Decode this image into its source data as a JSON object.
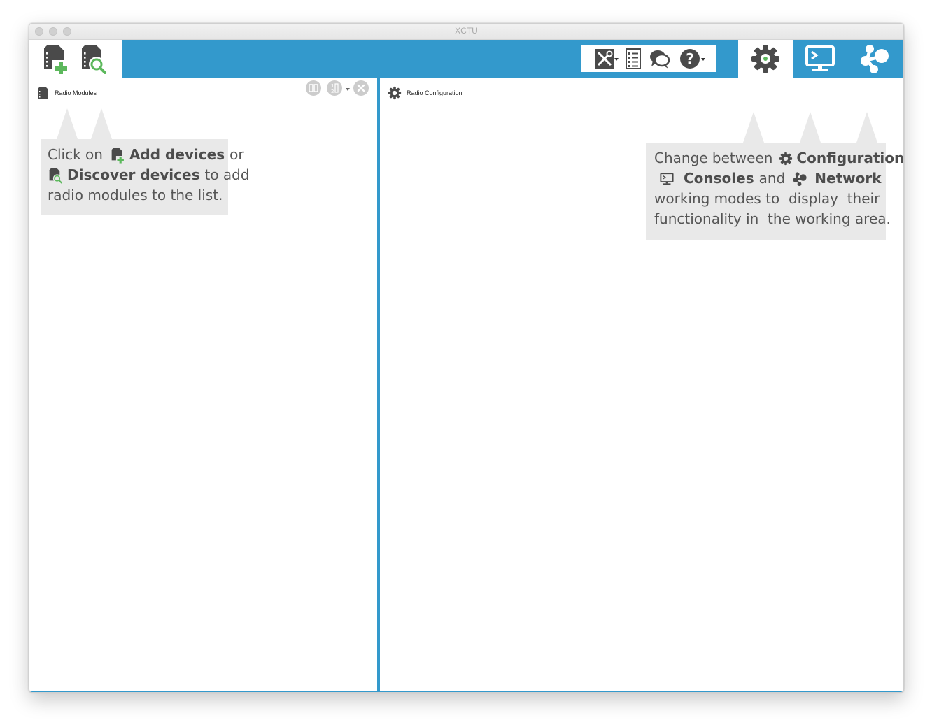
{
  "window": {
    "title": "XCTU"
  },
  "toolbar": {
    "left_buttons": [
      "add-devices",
      "discover-devices"
    ],
    "tools": [
      "tools",
      "xctu-log",
      "feedback",
      "help"
    ],
    "modes": [
      "configuration",
      "consoles",
      "network"
    ],
    "active_mode": "configuration"
  },
  "radio_modules": {
    "title": "Radio Modules",
    "tip": {
      "l1_a": "Click on",
      "l1_b": "Add devices",
      "l1_c": "or",
      "l2_b": "Discover devices",
      "l2_c": "to add",
      "l3": "radio modules to the list."
    }
  },
  "radio_configuration": {
    "title": "Radio Configuration",
    "tip": {
      "l1_a": "Change between",
      "l1_b": "Configuration",
      "l1_c": ",",
      "l2_b": "Consoles",
      "l2_c": "and",
      "l2_d": "Network",
      "l3": "working modes to  display  their",
      "l4": "functionality in  the working area."
    }
  },
  "colors": {
    "accent": "#3399cc",
    "tip_bg": "#e9e9e9",
    "icon_dark": "#4a4a4a",
    "icon_green": "#5cb85c"
  }
}
